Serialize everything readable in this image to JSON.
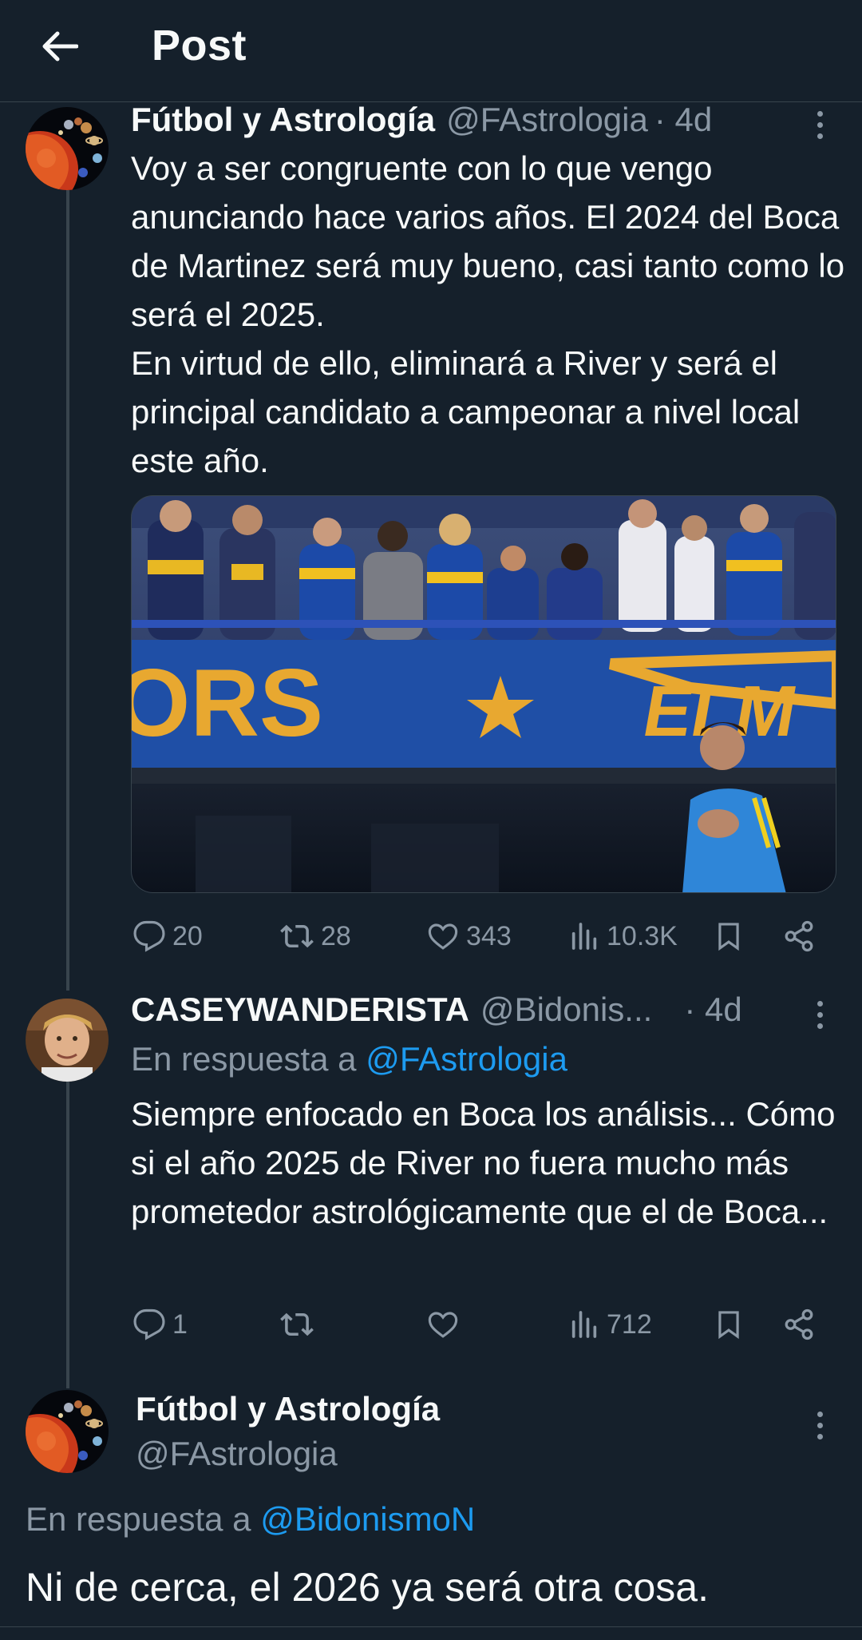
{
  "header": {
    "title": "Post",
    "back_icon": "arrow-left-icon"
  },
  "tweets": [
    {
      "name": "Fútbol y Astrología",
      "handle": "@FAstrologia",
      "time": "· 4d",
      "text": "Voy a ser congruente con lo que vengo anunciando hace varios años. El 2024 del Boca de Martinez será muy bueno, casi tanto como lo será el 2025.\nEn virtud de ello, eliminará a River y será el principal candidato a campeonar a nivel local este año.",
      "stats": {
        "replies": "20",
        "retweets": "28",
        "likes": "343",
        "views": "10.3K"
      }
    },
    {
      "name": "CASEYWANDERISTA",
      "handle": "@Bidonis...",
      "time": "· 4d",
      "reply_prefix": "En respuesta a ",
      "reply_to": "@FAstrologia",
      "text": "Siempre enfocado en Boca los análisis... Cómo si el año 2025 de River no fuera mucho más prometedor astrológicamente que el de Boca...",
      "stats": {
        "replies": "1",
        "retweets": "",
        "likes": "",
        "views": "712"
      }
    },
    {
      "name": "Fútbol y Astrología",
      "handle": "@FAstrologia",
      "reply_prefix": "En respuesta a ",
      "reply_to": "@BidonismoN",
      "text": "Ni de cerca, el 2026 ya será otra cosa."
    }
  ],
  "colors": {
    "background": "#15202b",
    "accent": "#1d9bf0",
    "muted": "#8b98a5",
    "divider": "#38444d"
  }
}
